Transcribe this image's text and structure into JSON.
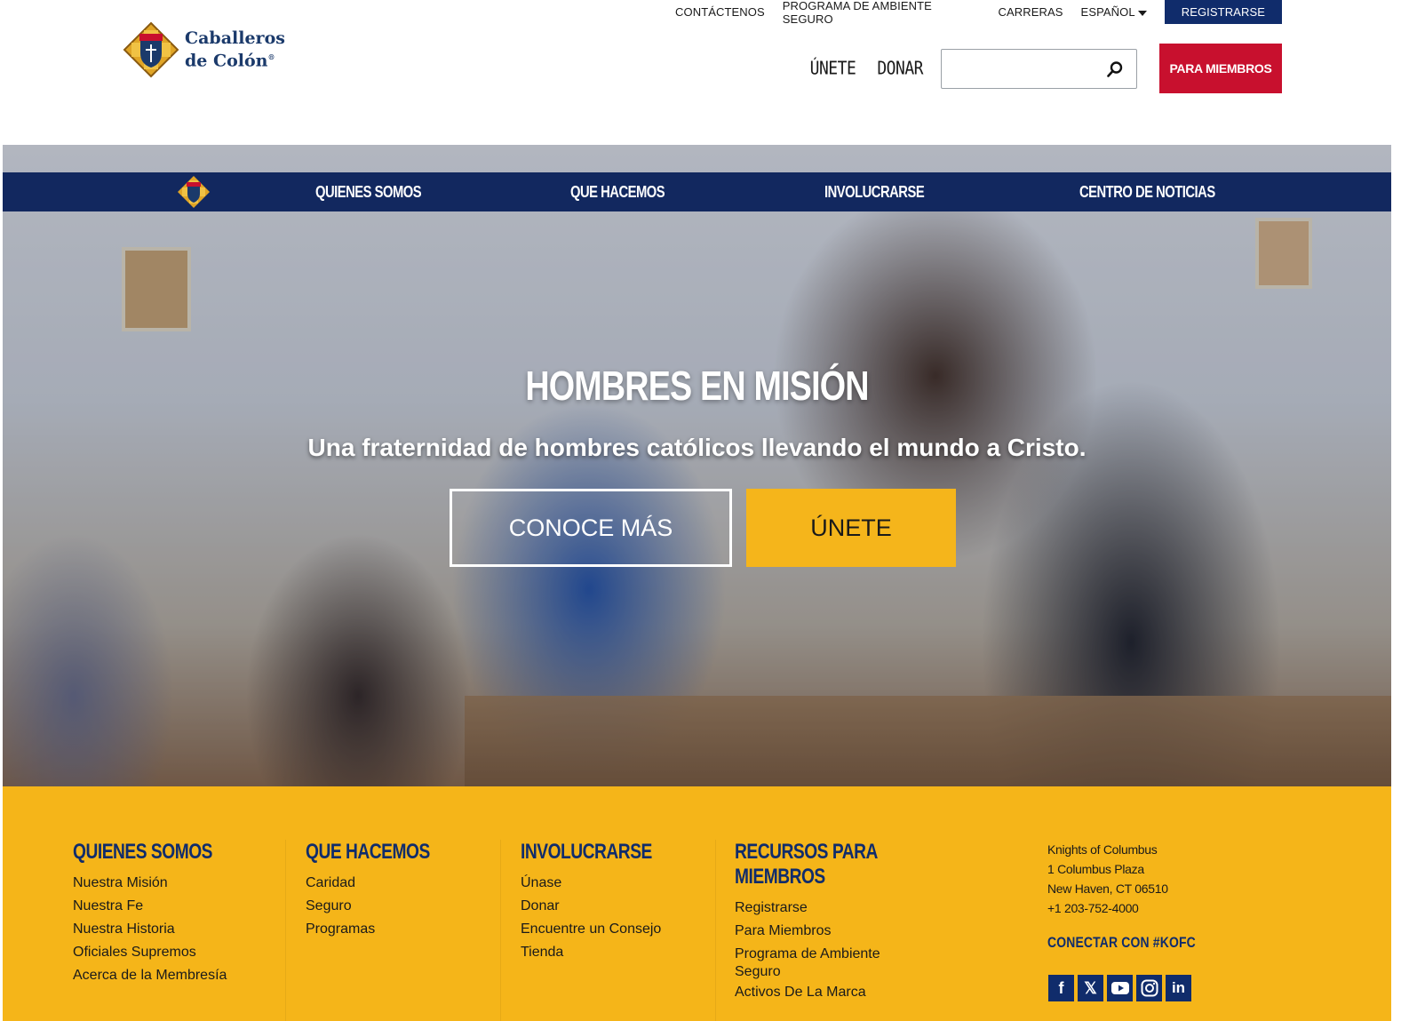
{
  "header": {
    "logo_line1": "Caballeros",
    "logo_line2": "de Colón",
    "utility": {
      "contact": "CONTÁCTENOS",
      "safe_env": "PROGRAMA DE AMBIENTE SEGURO",
      "careers": "CARRERAS",
      "language": "ESPAÑOL",
      "register": "REGISTRARSE"
    },
    "main": {
      "join": "ÚNETE",
      "donate": "DONAR",
      "search_value": "",
      "members": "PARA MIEMBROS"
    }
  },
  "catnav": {
    "items": [
      "QUIENES SOMOS",
      "QUE HACEMOS",
      "INVOLUCRARSE",
      "CENTRO DE NOTICIAS"
    ]
  },
  "hero": {
    "title": "HOMBRES EN MISIÓN",
    "subtitle": "Una fraternidad de hombres católicos llevando el mundo a Cristo.",
    "learn_more": "CONOCE MÁS",
    "join": "ÚNETE"
  },
  "footer": {
    "columns": [
      {
        "title": "QUIENES SOMOS",
        "links": [
          "Nuestra Misión",
          "Nuestra Fe",
          "Nuestra Historia",
          "Oficiales Supremos",
          "Acerca de la Membresía"
        ]
      },
      {
        "title": "QUE HACEMOS",
        "links": [
          "Caridad",
          "Seguro",
          "Programas"
        ]
      },
      {
        "title": "INVOLUCRARSE",
        "links": [
          "Únase",
          "Donar",
          "Encuentre un Consejo",
          "Tienda"
        ]
      },
      {
        "title_line1": "RECURSOS PARA",
        "title_line2": "MIEMBROS",
        "links": [
          "Registrarse",
          "Para Miembros",
          "Programa de Ambiente",
          "Seguro",
          "Activos De La Marca"
        ]
      }
    ],
    "address": [
      "Knights of Columbus",
      "1 Columbus Plaza",
      "New Haven, CT 06510",
      "+1 203-752-4000"
    ],
    "connect": "CONECTAR CON #KOFC",
    "social": [
      "facebook-icon",
      "x-icon",
      "youtube-icon",
      "instagram-icon",
      "linkedin-icon"
    ]
  },
  "colors": {
    "navy": "#102c6b",
    "red": "#c8102e",
    "gold": "#f5b519"
  }
}
